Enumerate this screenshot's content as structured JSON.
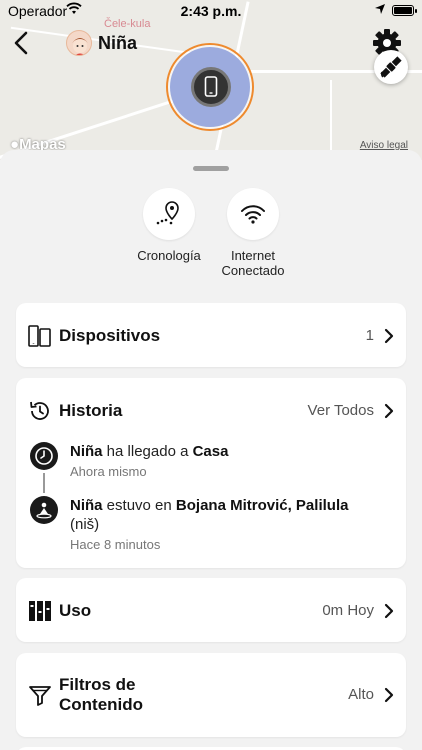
{
  "status_bar": {
    "carrier": "Operador",
    "time": "2:43 p.m."
  },
  "map": {
    "street_label": "Čele-kula",
    "brand": "Mapas",
    "legal": "Aviso legal"
  },
  "header": {
    "child_name": "Niña"
  },
  "quick_actions": [
    {
      "label": "Cronología",
      "icon": "timeline-pin-icon"
    },
    {
      "label": "Internet\nConectado",
      "icon": "wifi-icon"
    }
  ],
  "devices": {
    "title": "Dispositivos",
    "value": "1"
  },
  "history": {
    "title": "Historia",
    "action": "Ver Todos",
    "events": [
      {
        "name": "Niña",
        "verb": " ha llegado a ",
        "place": "Casa",
        "time": "Ahora mismo"
      },
      {
        "name": "Niña",
        "verb": " estuvo en ",
        "place": "Bojana Mitrović, Palilula",
        "suffix": "(niš)",
        "time": "Hace 8 minutos"
      }
    ]
  },
  "usage": {
    "title": "Uso",
    "value": "0m Hoy"
  },
  "filters": {
    "title": "Filtros de\nContenido",
    "value": "Alto"
  },
  "colors": {
    "accent_ring": "#ee8a2e",
    "pulse": "#9cabde"
  }
}
